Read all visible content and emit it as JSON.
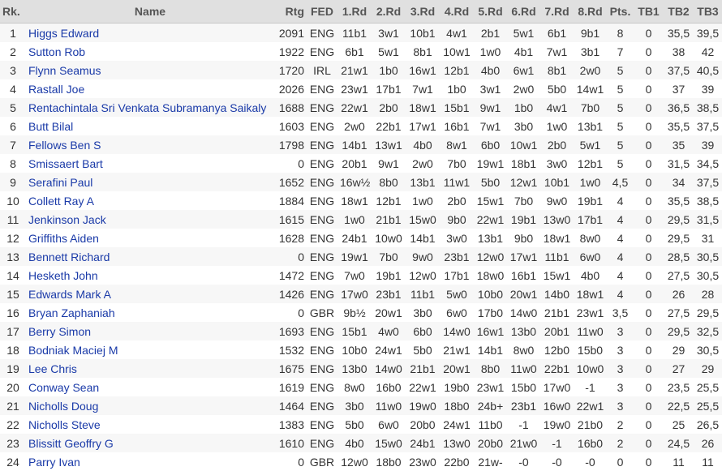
{
  "columns": [
    "Rk.",
    "Name",
    "Rtg",
    "FED",
    "1.Rd",
    "2.Rd",
    "3.Rd",
    "4.Rd",
    "5.Rd",
    "6.Rd",
    "7.Rd",
    "8.Rd",
    "Pts.",
    "TB1",
    "TB2",
    "TB3"
  ],
  "rows": [
    [
      "1",
      "Higgs Edward",
      "2091",
      "ENG",
      "11b1",
      "3w1",
      "10b1",
      "4w1",
      "2b1",
      "5w1",
      "6b1",
      "9b1",
      "8",
      "0",
      "35,5",
      "39,5"
    ],
    [
      "2",
      "Sutton Rob",
      "1922",
      "ENG",
      "6b1",
      "5w1",
      "8b1",
      "10w1",
      "1w0",
      "4b1",
      "7w1",
      "3b1",
      "7",
      "0",
      "38",
      "42"
    ],
    [
      "3",
      "Flynn Seamus",
      "1720",
      "IRL",
      "21w1",
      "1b0",
      "16w1",
      "12b1",
      "4b0",
      "6w1",
      "8b1",
      "2w0",
      "5",
      "0",
      "37,5",
      "40,5"
    ],
    [
      "4",
      "Rastall Joe",
      "2026",
      "ENG",
      "23w1",
      "17b1",
      "7w1",
      "1b0",
      "3w1",
      "2w0",
      "5b0",
      "14w1",
      "5",
      "0",
      "37",
      "39"
    ],
    [
      "5",
      "Rentachintala Sri Venkata Subramanya Saikaly",
      "1688",
      "ENG",
      "22w1",
      "2b0",
      "18w1",
      "15b1",
      "9w1",
      "1b0",
      "4w1",
      "7b0",
      "5",
      "0",
      "36,5",
      "38,5"
    ],
    [
      "6",
      "Butt Bilal",
      "1603",
      "ENG",
      "2w0",
      "22b1",
      "17w1",
      "16b1",
      "7w1",
      "3b0",
      "1w0",
      "13b1",
      "5",
      "0",
      "35,5",
      "37,5"
    ],
    [
      "7",
      "Fellows Ben S",
      "1798",
      "ENG",
      "14b1",
      "13w1",
      "4b0",
      "8w1",
      "6b0",
      "10w1",
      "2b0",
      "5w1",
      "5",
      "0",
      "35",
      "39"
    ],
    [
      "8",
      "Smissaert Bart",
      "0",
      "ENG",
      "20b1",
      "9w1",
      "2w0",
      "7b0",
      "19w1",
      "18b1",
      "3w0",
      "12b1",
      "5",
      "0",
      "31,5",
      "34,5"
    ],
    [
      "9",
      "Serafini Paul",
      "1652",
      "ENG",
      "16w½",
      "8b0",
      "13b1",
      "11w1",
      "5b0",
      "12w1",
      "10b1",
      "1w0",
      "4,5",
      "0",
      "34",
      "37,5"
    ],
    [
      "10",
      "Collett Ray A",
      "1884",
      "ENG",
      "18w1",
      "12b1",
      "1w0",
      "2b0",
      "15w1",
      "7b0",
      "9w0",
      "19b1",
      "4",
      "0",
      "35,5",
      "38,5"
    ],
    [
      "11",
      "Jenkinson Jack",
      "1615",
      "ENG",
      "1w0",
      "21b1",
      "15w0",
      "9b0",
      "22w1",
      "19b1",
      "13w0",
      "17b1",
      "4",
      "0",
      "29,5",
      "31,5"
    ],
    [
      "12",
      "Griffiths Aiden",
      "1628",
      "ENG",
      "24b1",
      "10w0",
      "14b1",
      "3w0",
      "13b1",
      "9b0",
      "18w1",
      "8w0",
      "4",
      "0",
      "29,5",
      "31"
    ],
    [
      "13",
      "Bennett Richard",
      "0",
      "ENG",
      "19w1",
      "7b0",
      "9w0",
      "23b1",
      "12w0",
      "17w1",
      "11b1",
      "6w0",
      "4",
      "0",
      "28,5",
      "30,5"
    ],
    [
      "14",
      "Hesketh John",
      "1472",
      "ENG",
      "7w0",
      "19b1",
      "12w0",
      "17b1",
      "18w0",
      "16b1",
      "15w1",
      "4b0",
      "4",
      "0",
      "27,5",
      "30,5"
    ],
    [
      "15",
      "Edwards Mark A",
      "1426",
      "ENG",
      "17w0",
      "23b1",
      "11b1",
      "5w0",
      "10b0",
      "20w1",
      "14b0",
      "18w1",
      "4",
      "0",
      "26",
      "28"
    ],
    [
      "16",
      "Bryan Zaphaniah",
      "0",
      "GBR",
      "9b½",
      "20w1",
      "3b0",
      "6w0",
      "17b0",
      "14w0",
      "21b1",
      "23w1",
      "3,5",
      "0",
      "27,5",
      "29,5"
    ],
    [
      "17",
      "Berry Simon",
      "1693",
      "ENG",
      "15b1",
      "4w0",
      "6b0",
      "14w0",
      "16w1",
      "13b0",
      "20b1",
      "11w0",
      "3",
      "0",
      "29,5",
      "32,5"
    ],
    [
      "18",
      "Bodniak Maciej M",
      "1532",
      "ENG",
      "10b0",
      "24w1",
      "5b0",
      "21w1",
      "14b1",
      "8w0",
      "12b0",
      "15b0",
      "3",
      "0",
      "29",
      "30,5"
    ],
    [
      "19",
      "Lee Chris",
      "1675",
      "ENG",
      "13b0",
      "14w0",
      "21b1",
      "20w1",
      "8b0",
      "11w0",
      "22b1",
      "10w0",
      "3",
      "0",
      "27",
      "29"
    ],
    [
      "20",
      "Conway Sean",
      "1619",
      "ENG",
      "8w0",
      "16b0",
      "22w1",
      "19b0",
      "23w1",
      "15b0",
      "17w0",
      "-1",
      "3",
      "0",
      "23,5",
      "25,5"
    ],
    [
      "21",
      "Nicholls Doug",
      "1464",
      "ENG",
      "3b0",
      "11w0",
      "19w0",
      "18b0",
      "24b+",
      "23b1",
      "16w0",
      "22w1",
      "3",
      "0",
      "22,5",
      "25,5"
    ],
    [
      "22",
      "Nicholls Steve",
      "1383",
      "ENG",
      "5b0",
      "6w0",
      "20b0",
      "24w1",
      "11b0",
      "-1",
      "19w0",
      "21b0",
      "2",
      "0",
      "25",
      "26,5"
    ],
    [
      "23",
      "Blissitt Geoffry G",
      "1610",
      "ENG",
      "4b0",
      "15w0",
      "24b1",
      "13w0",
      "20b0",
      "21w0",
      "-1",
      "16b0",
      "2",
      "0",
      "24,5",
      "26"
    ],
    [
      "24",
      "Parry Ivan",
      "0",
      "GBR",
      "12w0",
      "18b0",
      "23w0",
      "22b0",
      "21w-",
      "-0",
      "-0",
      "-0",
      "0",
      "0",
      "11",
      "11"
    ]
  ]
}
